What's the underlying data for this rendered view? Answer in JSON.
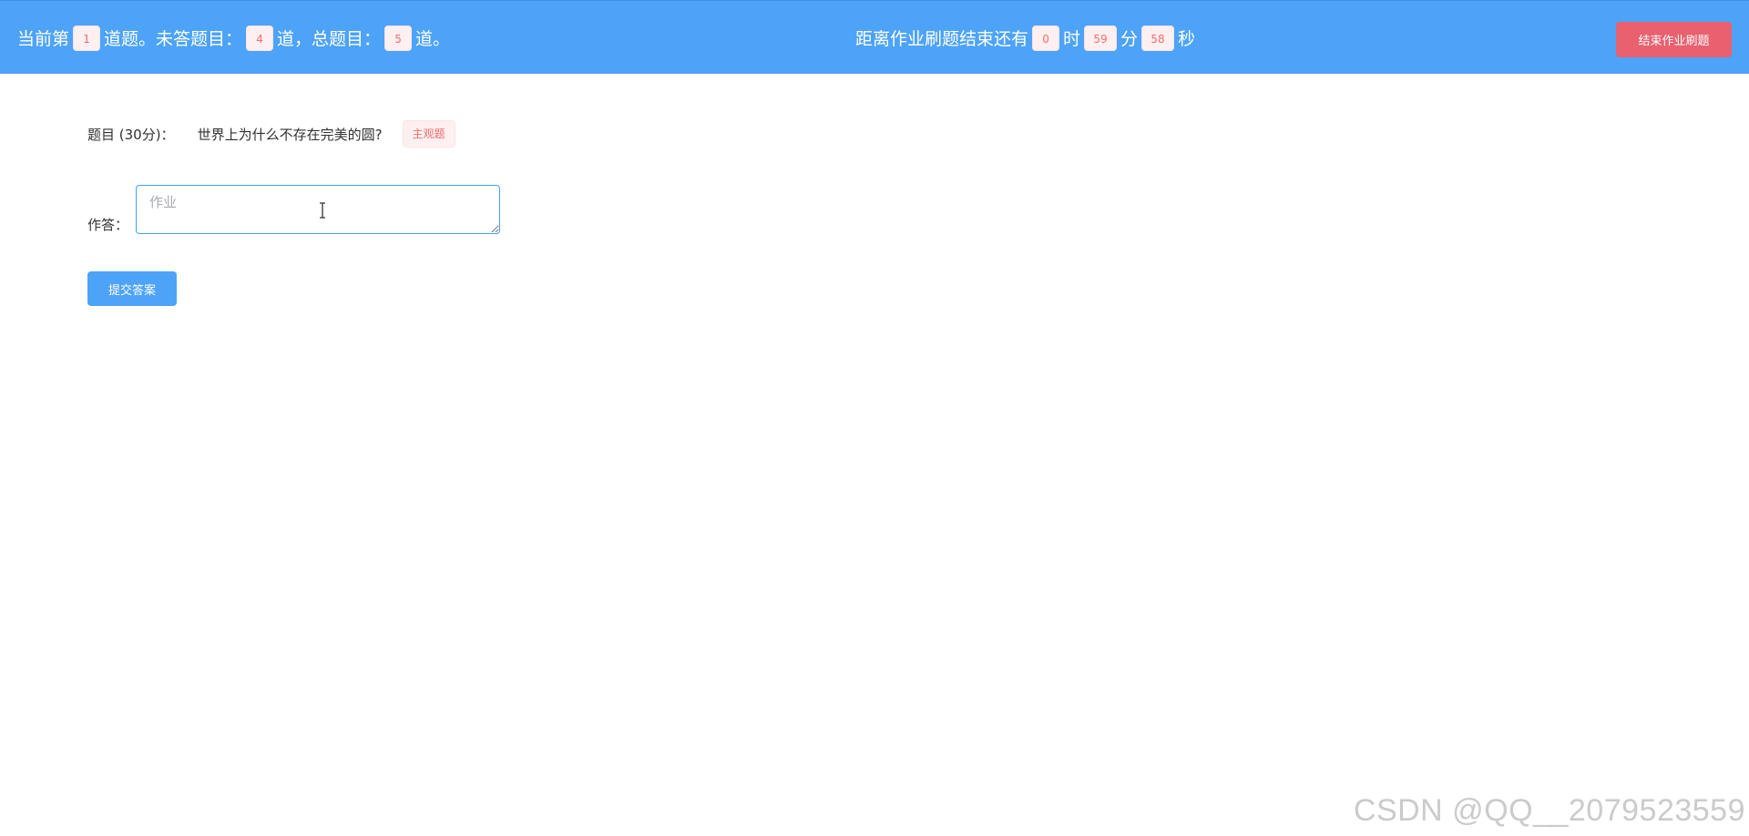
{
  "header": {
    "status": {
      "prefix": "当前第",
      "current_index": "1",
      "mid1": "道题。未答题目：",
      "unanswered": "4",
      "mid2": "道，总题目：",
      "total": "5",
      "suffix": "道。"
    },
    "timer": {
      "prefix": "距离作业刷题结束还有",
      "hours": "0",
      "hours_unit": "时",
      "minutes": "59",
      "minutes_unit": "分",
      "seconds": "58",
      "seconds_unit": "秒"
    },
    "end_button_label": "结束作业刷题"
  },
  "question": {
    "label": "题目 (30分)：",
    "text": "世界上为什么不存在完美的圆?",
    "type_tag": "主观题"
  },
  "answer": {
    "label": "作答：",
    "placeholder": "作业",
    "value": ""
  },
  "submit_label": "提交答案",
  "watermark": "CSDN @QQ__2079523559",
  "colors": {
    "header_bg": "#4da3f7",
    "danger_button": "#e9606e",
    "tag_text": "#f56c6c",
    "tag_bg": "#fef0f0"
  }
}
